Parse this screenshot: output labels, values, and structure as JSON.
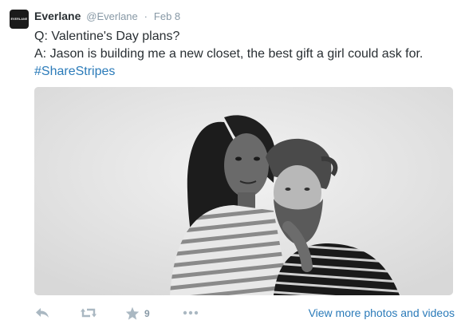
{
  "tweet": {
    "avatar_text": "EVERLANE",
    "author_name": "Everlane",
    "handle": "@Everlane",
    "separator": "·",
    "time": "Feb 8",
    "lines": [
      "Q: Valentine's Day plans?",
      "A: Jason is building me a new closet, the best gift a girl could ask for."
    ],
    "hashtag": "#ShareStripes"
  },
  "actions": {
    "reply_icon": "reply-icon",
    "retweet_icon": "retweet-icon",
    "favorite_icon": "star-icon",
    "favorite_count": "9",
    "more_icon": "more-icon",
    "view_more_label": "View more photos and videos"
  },
  "colors": {
    "link": "#2b7bb9",
    "muted": "#8899a6",
    "text": "#292f33"
  }
}
